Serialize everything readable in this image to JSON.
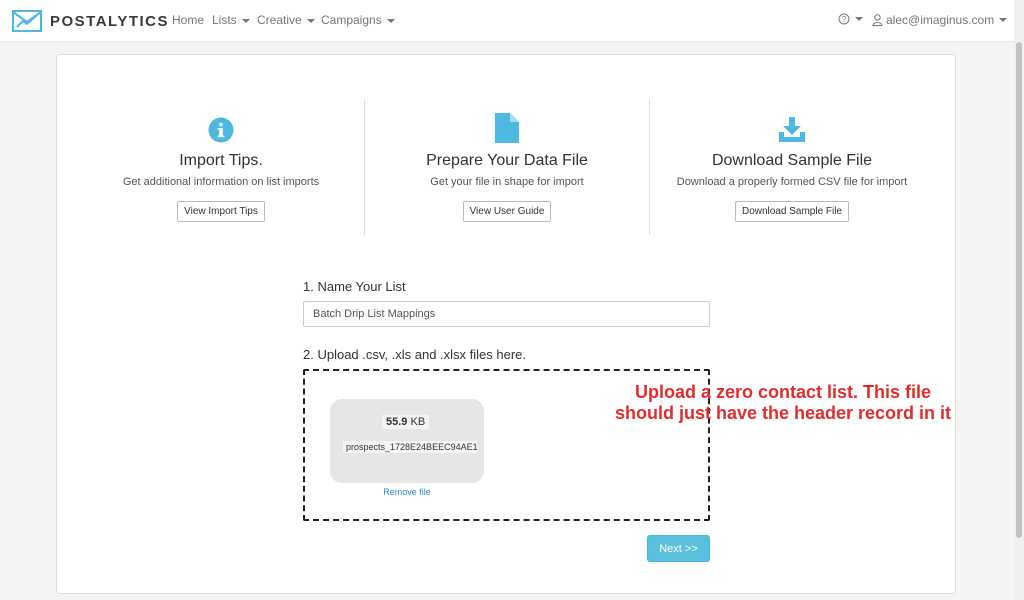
{
  "brand": {
    "name": "POSTALYTICS"
  },
  "nav": {
    "home": "Home",
    "lists": "Lists",
    "creative": "Creative",
    "campaigns": "Campaigns",
    "user_email": "alec@imaginus.com"
  },
  "features": [
    {
      "icon": "info-icon",
      "title": "Import Tips.",
      "description": "Get additional information on list imports",
      "button": "View Import Tips"
    },
    {
      "icon": "document-icon",
      "title": "Prepare Your Data File",
      "description": "Get your file in shape for import",
      "button": "View User Guide"
    },
    {
      "icon": "download-icon",
      "title": "Download Sample File",
      "description": "Download a properly formed CSV file for import",
      "button": "Download Sample File"
    }
  ],
  "form": {
    "step1_label": "1. Name Your List",
    "list_name_value": "Batch Drip List Mappings",
    "step2_label": "2. Upload .csv, .xls and .xlsx files here.",
    "file": {
      "size_value": "55.9",
      "size_unit": "KB",
      "name": "prospects_1728E24BEEC94AE1...",
      "remove_label": "Remove file"
    },
    "next_label": "Next >>"
  },
  "annotation": {
    "line1": "Upload a zero contact list. This file",
    "line2": "should just have the header record in it"
  },
  "colors": {
    "accent": "#5bc0de",
    "icon": "#4fb8e0",
    "link": "#2a8ac9",
    "annotation": "#e02d2d"
  }
}
